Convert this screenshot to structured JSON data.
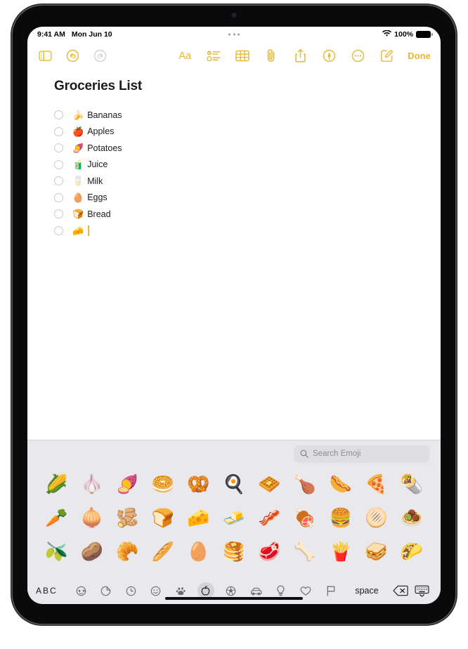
{
  "status_bar": {
    "time": "9:41 AM",
    "date": "Mon Jun 10",
    "battery_percent": "100%",
    "wifi_icon": "wifi-icon",
    "battery_icon": "battery-full-icon",
    "multitask_icon": "multitasking-dots-icon"
  },
  "toolbar": {
    "sidebar_icon": "sidebar-toggle-icon",
    "undo_icon": "undo-icon",
    "redo_icon": "redo-icon",
    "format_label": "Aa",
    "checklist_icon": "checklist-icon",
    "table_icon": "table-icon",
    "attach_icon": "paperclip-icon",
    "share_icon": "share-icon",
    "markup_icon": "markup-pen-icon",
    "more_icon": "more-ellipsis-icon",
    "compose_icon": "compose-icon",
    "done_label": "Done"
  },
  "note": {
    "title": "Groceries List",
    "items": [
      {
        "emoji": "🍌",
        "text": "Bananas",
        "checked": false
      },
      {
        "emoji": "🍎",
        "text": "Apples",
        "checked": false
      },
      {
        "emoji": "🍠",
        "text": "Potatoes",
        "checked": false
      },
      {
        "emoji": "🧃",
        "text": "Juice",
        "checked": false
      },
      {
        "emoji": "🥛",
        "text": "Milk",
        "checked": false
      },
      {
        "emoji": "🥚",
        "text": "Eggs",
        "checked": false
      },
      {
        "emoji": "🍞",
        "text": "Bread",
        "checked": false
      },
      {
        "emoji": "🧀",
        "text": "",
        "checked": false,
        "cursor": true
      }
    ]
  },
  "keyboard": {
    "search": {
      "placeholder": "Search Emoji",
      "value": "",
      "icon": "search-icon"
    },
    "emoji_rows": [
      [
        "🌽",
        "🧄",
        "🍠",
        "🥯",
        "🥨",
        "🍳",
        "🧇",
        "🍗",
        "🌭",
        "🍕",
        "🌯"
      ],
      [
        "🥕",
        "🧅",
        "🫚",
        "🍞",
        "🧀",
        "🧈",
        "🥓",
        "🍖",
        "🍔",
        "🫓",
        "🧆"
      ],
      [
        "🫒",
        "🥔",
        "🥐",
        "🥖",
        "🥚",
        "🥞",
        "🥩",
        "🦴",
        "🍟",
        "🥪",
        "🌮"
      ]
    ],
    "bottom_bar": {
      "abc_label": "ABC",
      "space_label": "space",
      "delete_icon": "delete-backspace-icon",
      "dismiss_icon": "dismiss-keyboard-icon",
      "categories": [
        {
          "name": "frequently-used",
          "icon": "smiley-sunglasses-icon",
          "active": false
        },
        {
          "name": "stickers",
          "icon": "sticker-icon",
          "active": false
        },
        {
          "name": "recents",
          "icon": "clock-icon",
          "active": false
        },
        {
          "name": "smileys-people",
          "icon": "smiley-icon",
          "active": false
        },
        {
          "name": "animals-nature",
          "icon": "paw-print-icon",
          "active": false
        },
        {
          "name": "food-drink",
          "icon": "apple-fruit-icon",
          "active": true
        },
        {
          "name": "activity",
          "icon": "soccer-ball-icon",
          "active": false
        },
        {
          "name": "travel-places",
          "icon": "car-icon",
          "active": false
        },
        {
          "name": "objects",
          "icon": "lightbulb-icon",
          "active": false
        },
        {
          "name": "symbols",
          "icon": "heart-icon",
          "active": false
        },
        {
          "name": "flags",
          "icon": "flag-icon",
          "active": false
        }
      ]
    }
  },
  "colors": {
    "accent": "#E8B730",
    "keyboard_bg": "#E8E8ED",
    "note_bg": "#FFFFFF"
  },
  "home_indicator": "home-indicator"
}
